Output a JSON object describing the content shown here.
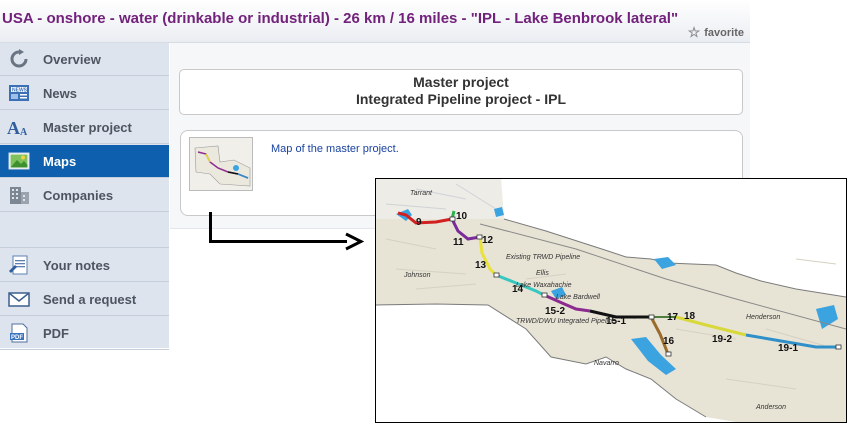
{
  "header": {
    "title": "USA - onshore - water (drinkable or industrial) - 26 km / 16 miles - \"IPL - Lake Benbrook lateral\"",
    "favorite_label": "favorite"
  },
  "sidebar": {
    "items": [
      {
        "label": "Overview",
        "icon": "refresh-icon"
      },
      {
        "label": "News",
        "icon": "news-icon"
      },
      {
        "label": "Master project",
        "icon": "font-icon"
      },
      {
        "label": "Maps",
        "icon": "map-icon",
        "active": true
      },
      {
        "label": "Companies",
        "icon": "building-icon"
      },
      {
        "label": "Your notes",
        "icon": "notes-icon"
      },
      {
        "label": "Send a request",
        "icon": "envelope-icon"
      },
      {
        "label": "PDF",
        "icon": "pdf-icon"
      }
    ]
  },
  "main": {
    "master_heading_line1": "Master project",
    "master_heading_line2": "Integrated Pipeline project - IPL",
    "map_link": "Map of the master project."
  },
  "map": {
    "place_labels": {
      "tarrant": "Tarrant",
      "johnson": "Johnson",
      "ellis": "Ellis",
      "navarro": "Navarro",
      "henderson": "Henderson",
      "anderson": "Anderson",
      "lake_waxahachie": "Lake Waxahachie",
      "lake_bardwell": "Lake Bardwell",
      "existing_pipeline": "Existing TRWD Pipeline",
      "trwd_pipeline": "TRWD/DWU Integrated Pipeline"
    },
    "segment_labels": [
      "9",
      "10",
      "11",
      "12",
      "13",
      "14",
      "15-2",
      "15-1",
      "16",
      "17",
      "18",
      "19-2",
      "19-1"
    ],
    "colors": {
      "seg9": "#d12020",
      "seg10": "#2bb34a",
      "seg11": "#7a2a9a",
      "seg13": "#e8e23a",
      "seg14": "#36c8c0",
      "seg15_2": "#8b2a8f",
      "seg15_1": "#111111",
      "seg16": "#9a6b2a",
      "seg19_2": "#d8d83a",
      "seg19_1": "#2f8fc8",
      "water": "#3aa3e0",
      "active_nav": "#0e5fae",
      "title": "#72227b"
    }
  }
}
